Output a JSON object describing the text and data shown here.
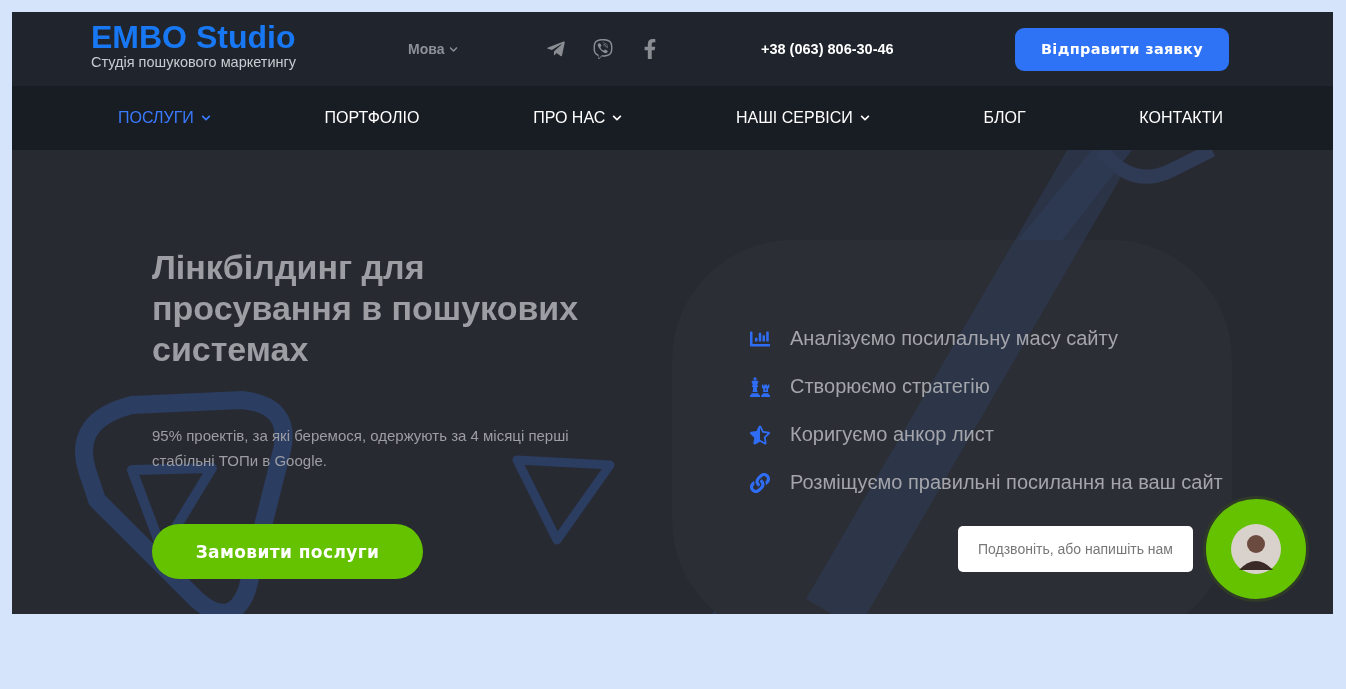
{
  "header": {
    "logo": {
      "title": "EMBO Studio",
      "subtitle": "Студія пошукового маркетингу"
    },
    "language": "Мова",
    "socials": [
      {
        "kind": "telegram"
      },
      {
        "kind": "viber"
      },
      {
        "kind": "facebook"
      }
    ],
    "phone": "+38 (063) 806-30-46",
    "cta": "Відправити заявку"
  },
  "nav": [
    {
      "label": "ПОСЛУГИ",
      "selected": true,
      "dropdown": true
    },
    {
      "label": "ПОРТФОЛІО",
      "selected": false,
      "dropdown": false
    },
    {
      "label": "ПРО НАС",
      "selected": false,
      "dropdown": true
    },
    {
      "label": "НАШІ СЕРВІСИ",
      "selected": false,
      "dropdown": true
    },
    {
      "label": "БЛОГ",
      "selected": false,
      "dropdown": false
    },
    {
      "label": "КОНТАКТИ",
      "selected": false,
      "dropdown": false
    }
  ],
  "hero": {
    "title": "Лінкбілдинг для просування в пошукових системах",
    "subtitle": "95% проектів, за які беремося, одержують за 4 місяці перші стабільні ТОПи в Google.",
    "button": "Замовити послуги",
    "features": [
      {
        "kind": "chart",
        "text": "Аналізуємо посилальну масу сайту"
      },
      {
        "kind": "chess",
        "text": "Створюємо стратегію"
      },
      {
        "kind": "star",
        "text": "Коригуємо анкор лист"
      },
      {
        "kind": "link",
        "text": "Розміщуємо правильні посилання на ваш сайт"
      }
    ]
  },
  "chat": {
    "message": "Подзвоніть, або напишіть нам"
  }
}
